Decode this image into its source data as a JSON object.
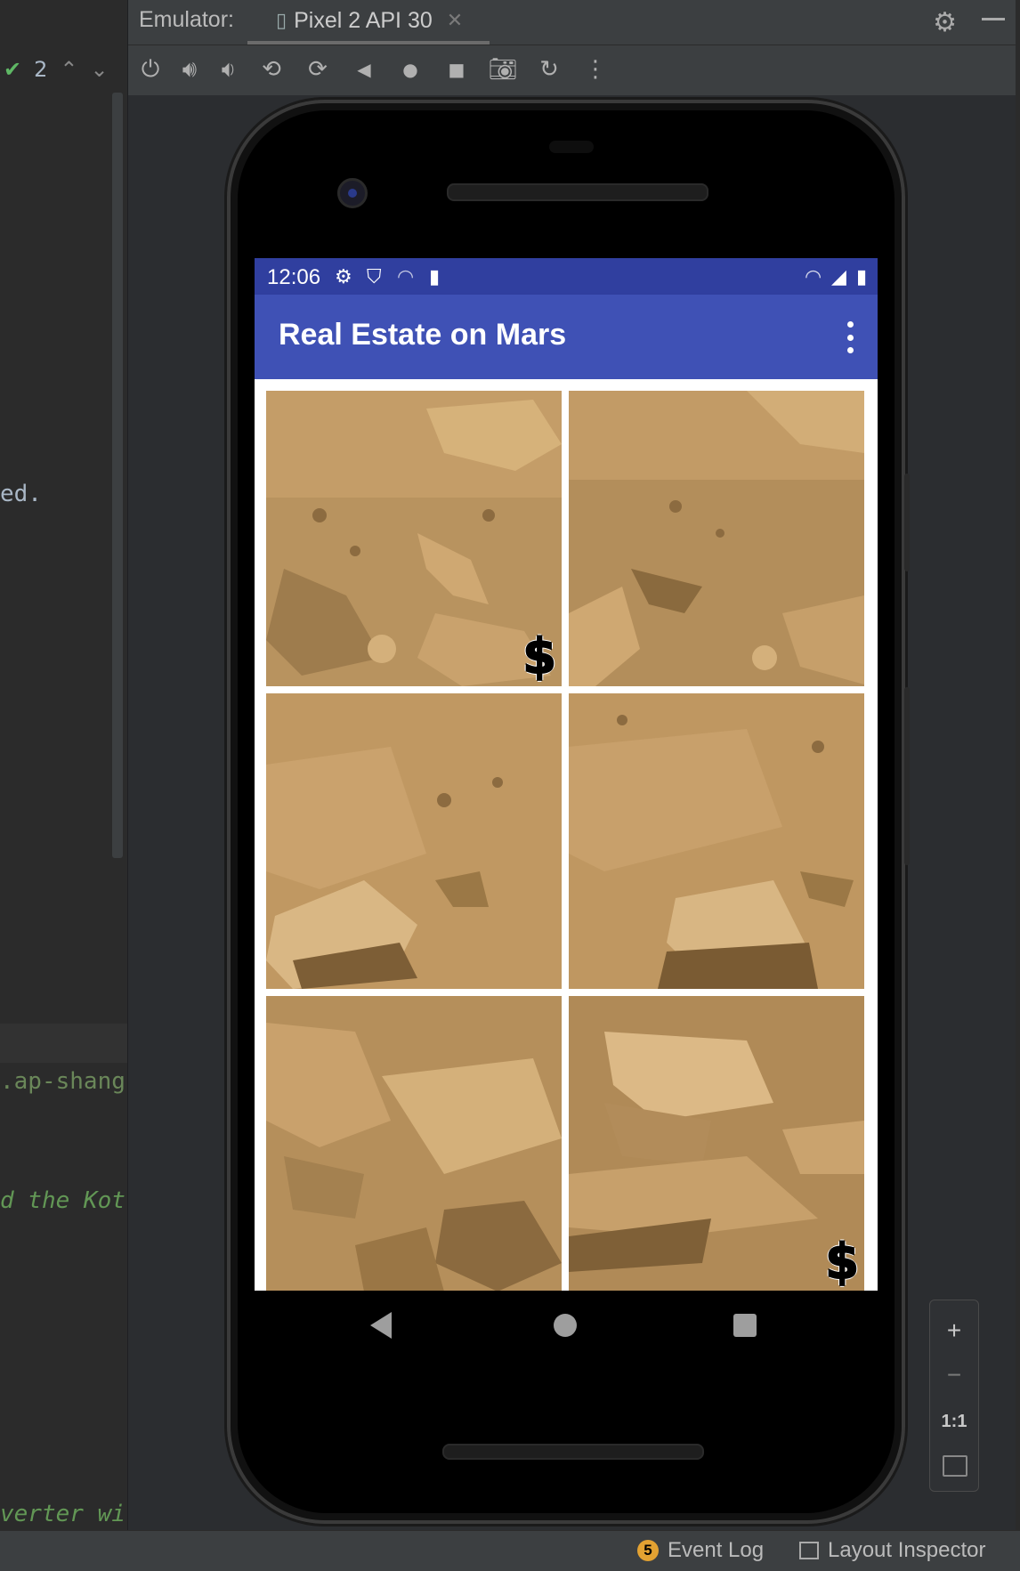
{
  "ide": {
    "left_toolbar": {
      "check_count": "2"
    },
    "code_fragments": [
      "ed.",
      ".ap-shangh",
      "d the Kotl",
      "verter wit"
    ]
  },
  "emulator": {
    "label": "Emulator:",
    "device_tab": "Pixel 2 API 30",
    "toolbar_icons": [
      "power-icon",
      "volume-up-icon",
      "volume-down-icon",
      "rotate-left-icon",
      "rotate-right-icon",
      "back-icon",
      "home-icon",
      "overview-icon",
      "screenshot-icon",
      "snapshot-icon",
      "more-icon"
    ]
  },
  "device": {
    "status_bar": {
      "time": "12:06"
    },
    "app": {
      "title": "Real Estate on Mars",
      "tiles": [
        {
          "has_price_tag": true,
          "tag": "$"
        },
        {
          "has_price_tag": false
        },
        {
          "has_price_tag": false
        },
        {
          "has_price_tag": false
        },
        {
          "has_price_tag": false
        },
        {
          "has_price_tag": true,
          "tag": "$"
        }
      ]
    },
    "nav_bar": [
      "back",
      "home",
      "recents"
    ]
  },
  "zoom": {
    "plus": "+",
    "minus": "−",
    "actual": "1:1"
  },
  "bottom_bar": {
    "event_log_count": "5",
    "event_log": "Event Log",
    "layout_inspector": "Layout Inspector"
  },
  "colors": {
    "status_bar": "#303f9f",
    "app_bar": "#3f51b5",
    "mars_sand": "#b8935f",
    "ide_bg": "#2b2b2b"
  }
}
